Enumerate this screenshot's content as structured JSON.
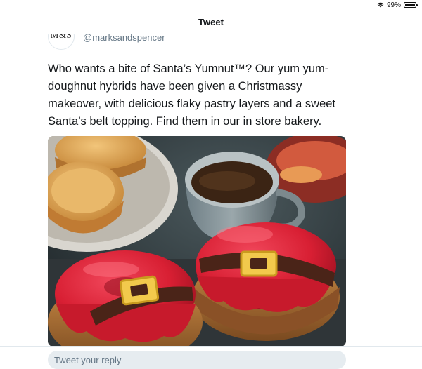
{
  "status_bar": {
    "battery": "99%",
    "battery_level": 0.99
  },
  "nav": {
    "title": "Tweet"
  },
  "tweet": {
    "avatar_text": "M&S",
    "handle": "@marksandspencer",
    "text": "Who wants a bite of Santa’s Yumnut™? Our yum yum-doughnut hybrids have been given a Christmassy makeover, with delicious flaky pastry layers and a sweet Santa’s belt topping. Find them in our in store bakery."
  },
  "reply": {
    "placeholder": "Tweet your reply"
  },
  "colors": {
    "text": "#14171a",
    "secondary": "#657786",
    "border": "#e1e8ed",
    "input_bg": "#e6ecf0"
  },
  "icons": {
    "wifi": "wifi-icon",
    "battery": "battery-icon"
  }
}
